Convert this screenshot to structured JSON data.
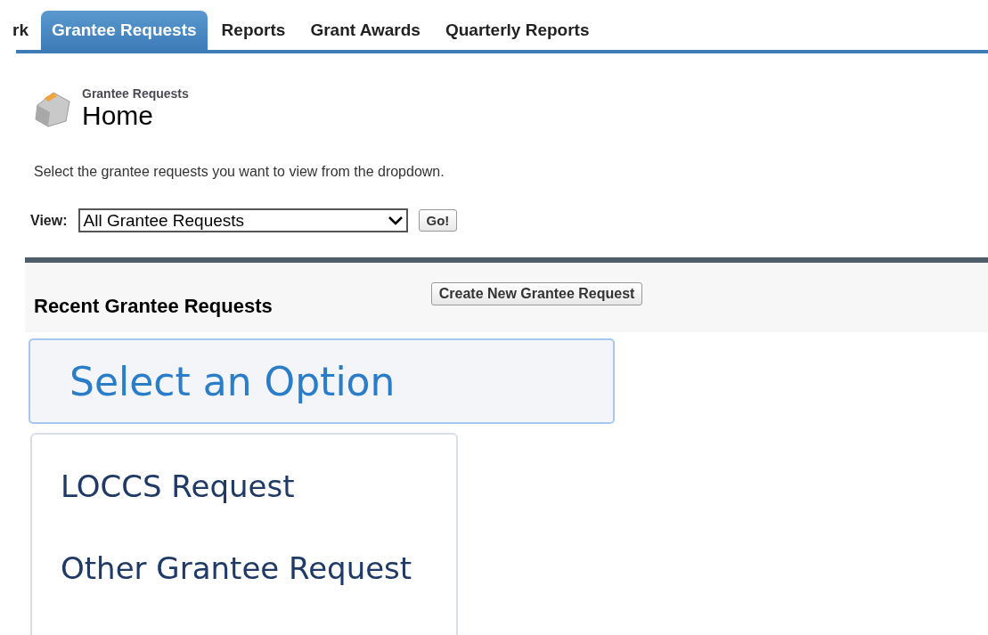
{
  "tabs": [
    {
      "label": "rk",
      "selected": false
    },
    {
      "label": "Grantee Requests",
      "selected": true
    },
    {
      "label": "Reports",
      "selected": false
    },
    {
      "label": "Grant Awards",
      "selected": false
    },
    {
      "label": "Quarterly Reports",
      "selected": false
    }
  ],
  "header": {
    "breadcrumb": "Grantee Requests",
    "title": "Home"
  },
  "intro": "Select the grantee requests you want to view from the dropdown.",
  "view": {
    "label": "View:",
    "value": "All Grantee Requests",
    "button": "Go!"
  },
  "recent": {
    "title": "Recent Grantee Requests",
    "button": "Create New Grantee Request"
  },
  "picker": {
    "placeholder": "Select an Option",
    "options": [
      "LOCCS Request",
      "Other Grantee Request"
    ]
  }
}
